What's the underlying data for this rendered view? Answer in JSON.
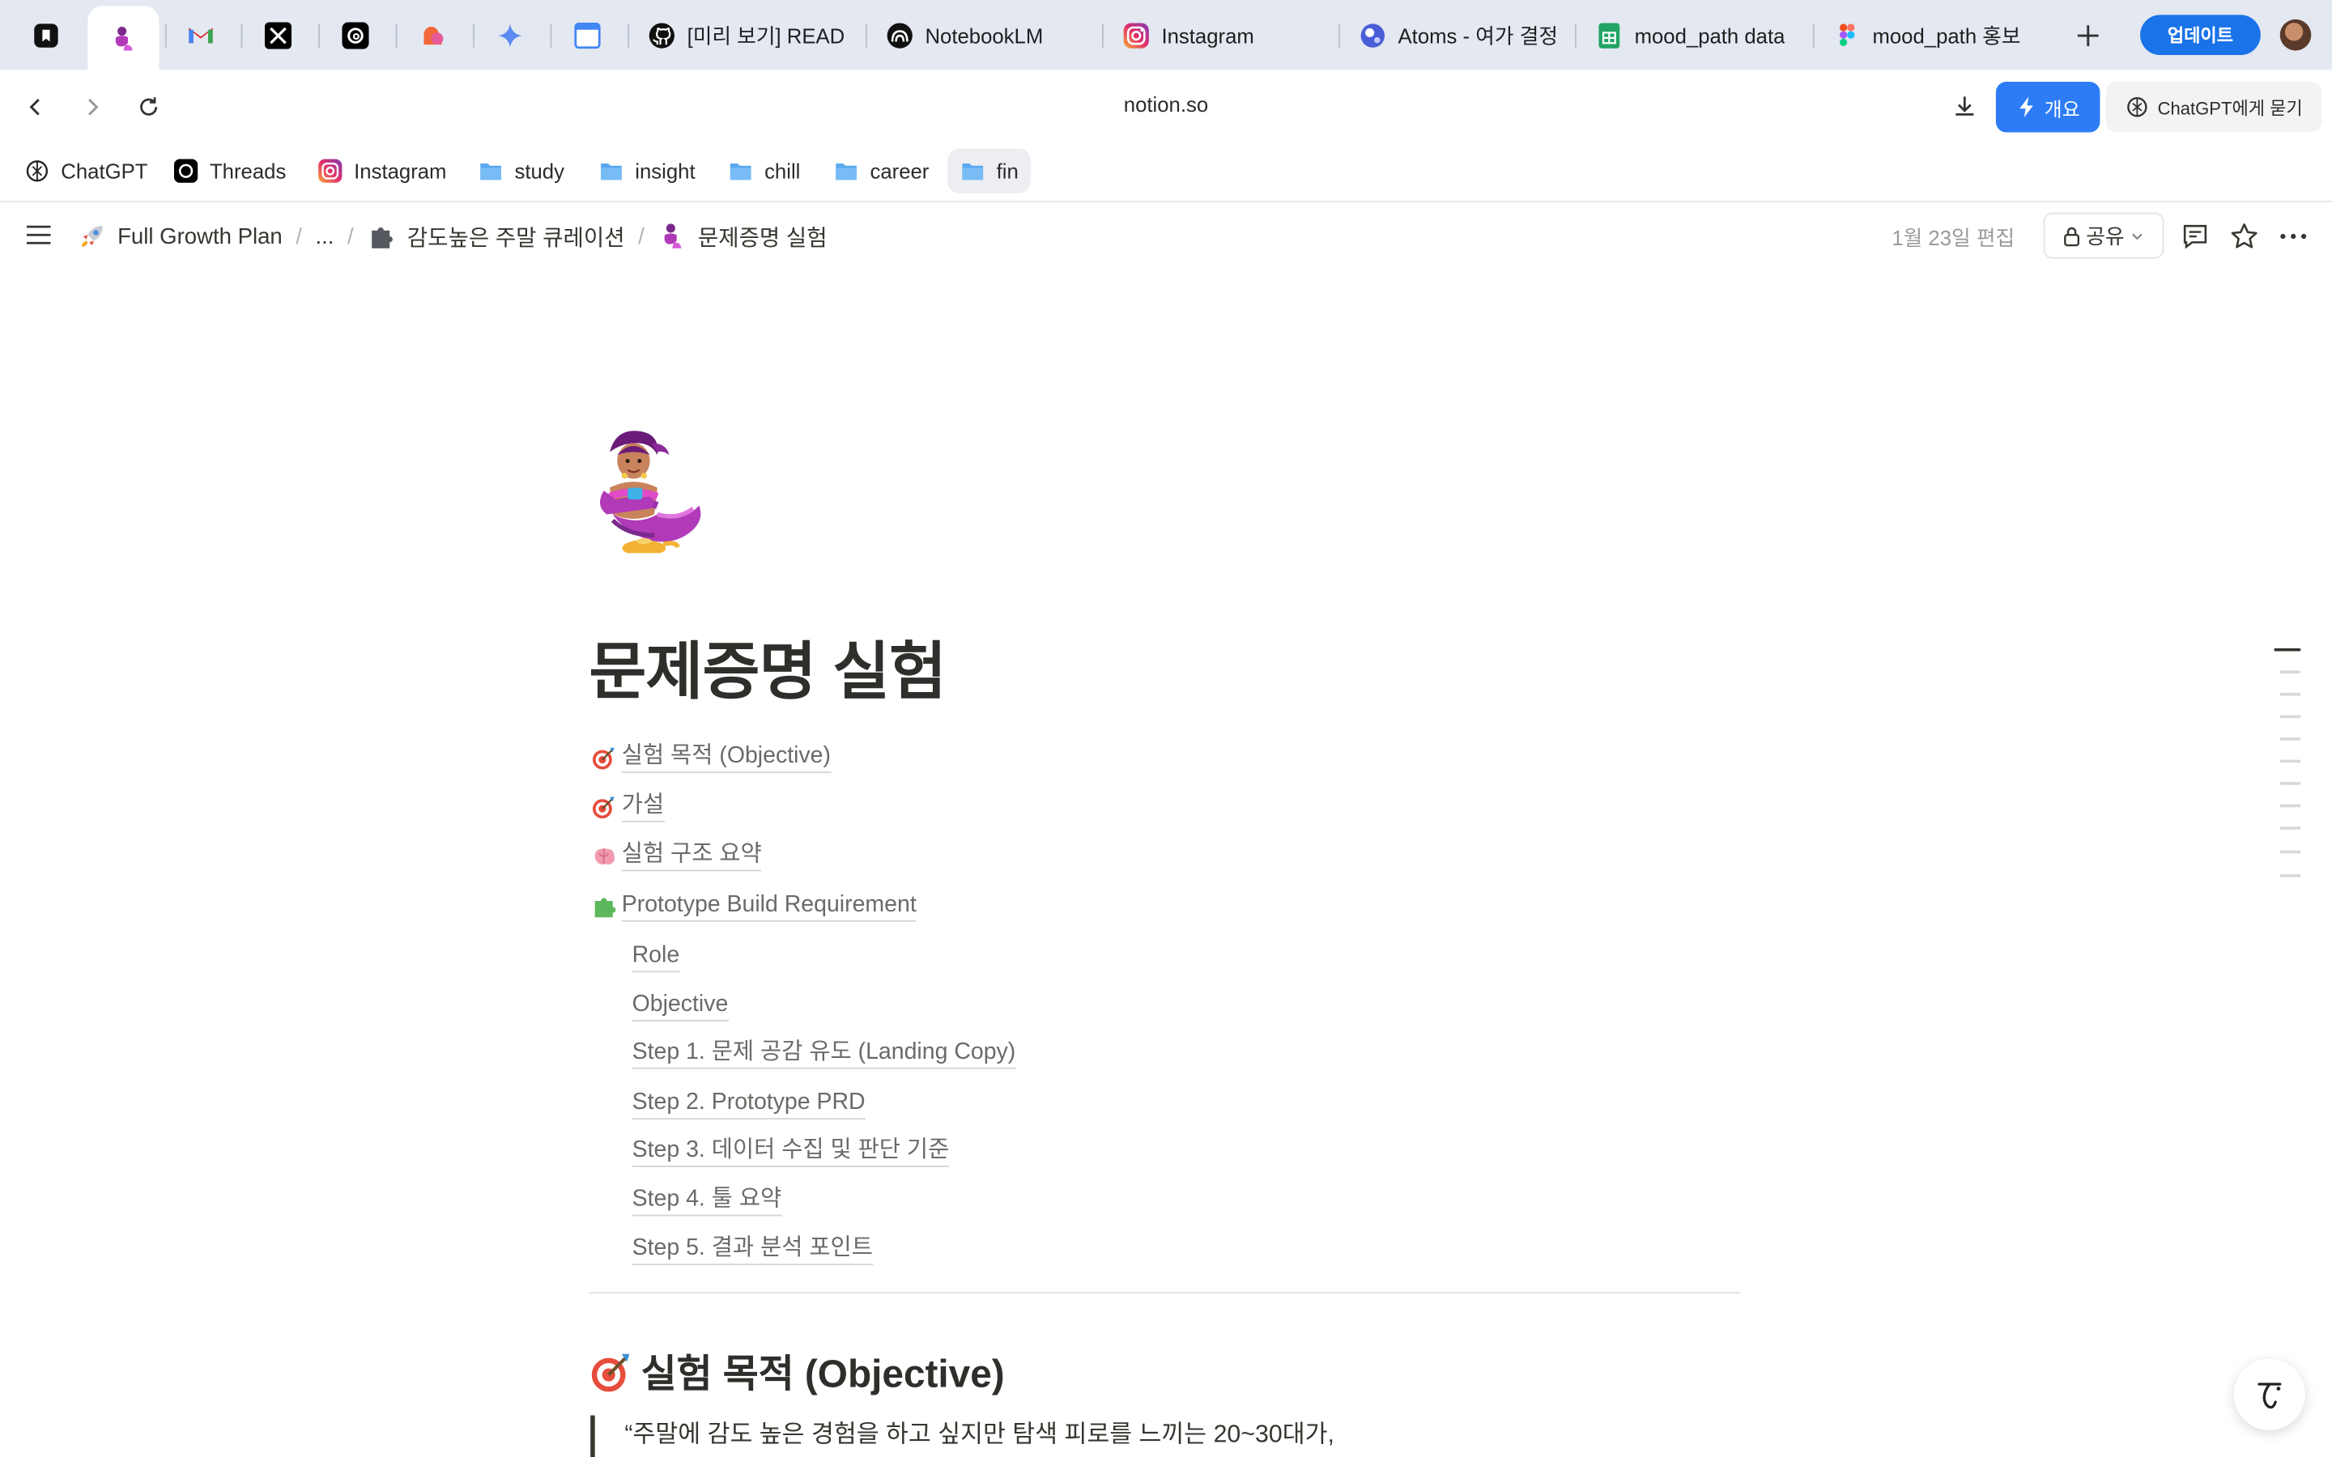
{
  "browser": {
    "tabs": [
      {
        "title": "",
        "icon": "bookmark-app-icon",
        "pinned": true
      },
      {
        "title": "",
        "icon": "genie-icon",
        "pinned": true,
        "active": true
      },
      {
        "title": "",
        "icon": "gmail-icon",
        "pinned": true
      },
      {
        "title": "",
        "icon": "x-icon",
        "pinned": true
      },
      {
        "title": "",
        "icon": "threads-icon",
        "pinned": true
      },
      {
        "title": "",
        "icon": "cloud-app-icon",
        "pinned": true
      },
      {
        "title": "",
        "icon": "gemini-icon",
        "pinned": true
      },
      {
        "title": "",
        "icon": "calendar-icon",
        "pinned": true
      },
      {
        "title": "[미리 보기] READ",
        "icon": "github-icon"
      },
      {
        "title": "NotebookLM",
        "icon": "notebooklm-icon"
      },
      {
        "title": "Instagram",
        "icon": "instagram-icon"
      },
      {
        "title": "Atoms - 여가 결정",
        "icon": "atoms-icon"
      },
      {
        "title": "mood_path data",
        "icon": "sheets-icon"
      },
      {
        "title": "mood_path 홍보",
        "icon": "figma-icon"
      }
    ],
    "calendar_day": "4",
    "update_label": "업데이트",
    "url": "notion.so",
    "summary_label": "개요",
    "chatgpt_label": "ChatGPT에게 묻기"
  },
  "bookmarks": [
    {
      "label": "ChatGPT",
      "icon": "chatgpt-icon"
    },
    {
      "label": "Threads",
      "icon": "threads-icon"
    },
    {
      "label": "Instagram",
      "icon": "instagram-icon"
    },
    {
      "label": "study",
      "icon": "folder-icon"
    },
    {
      "label": "insight",
      "icon": "folder-icon"
    },
    {
      "label": "chill",
      "icon": "folder-icon"
    },
    {
      "label": "career",
      "icon": "folder-icon"
    },
    {
      "label": "fin",
      "icon": "folder-icon",
      "selected": true
    }
  ],
  "notion": {
    "breadcrumbs": [
      {
        "label": "Full Growth Plan",
        "icon": "rocket-icon"
      },
      {
        "label": "...",
        "icon": ""
      },
      {
        "label": "감도높은 주말 큐레이션",
        "icon": "puzzle-icon"
      },
      {
        "label": "문제증명 실험",
        "icon": "genie-icon"
      }
    ],
    "edited": "1월 23일 편집",
    "share_label": "공유"
  },
  "page": {
    "title": "문제증명 실험",
    "icon": "genie-icon",
    "toc": [
      {
        "label": "실험 목적 (Objective)",
        "icon": "target-icon",
        "level": 0
      },
      {
        "label": "가설",
        "icon": "target-icon",
        "level": 0
      },
      {
        "label": "실험 구조 요약",
        "icon": "brain-icon",
        "level": 0
      },
      {
        "label": "Prototype Build Requirement",
        "icon": "puzzle-piece-icon",
        "level": 0
      },
      {
        "label": "Role",
        "icon": "",
        "level": 1
      },
      {
        "label": "Objective",
        "icon": "",
        "level": 1
      },
      {
        "label": "Step 1. 문제 공감 유도 (Landing Copy)",
        "icon": "",
        "level": 1
      },
      {
        "label": "Step 2. Prototype PRD",
        "icon": "",
        "level": 1
      },
      {
        "label": "Step 3. 데이터 수집 및 판단 기준",
        "icon": "",
        "level": 1
      },
      {
        "label": "Step 4. 툴 요약",
        "icon": "",
        "level": 1
      },
      {
        "label": "Step 5. 결과 분석 포인트",
        "icon": "",
        "level": 1
      }
    ],
    "section_heading": "실험 목적 (Objective)",
    "section_icon": "target-icon",
    "quote_text": "“주말에 감도 높은 경험을 하고 싶지만 탐색 피로를 느끼는 20~30대가,"
  },
  "colors": {
    "accent_blue": "#2d7cf6",
    "update_blue": "#1a73e8",
    "tabstrip": "#e3e8f1"
  }
}
